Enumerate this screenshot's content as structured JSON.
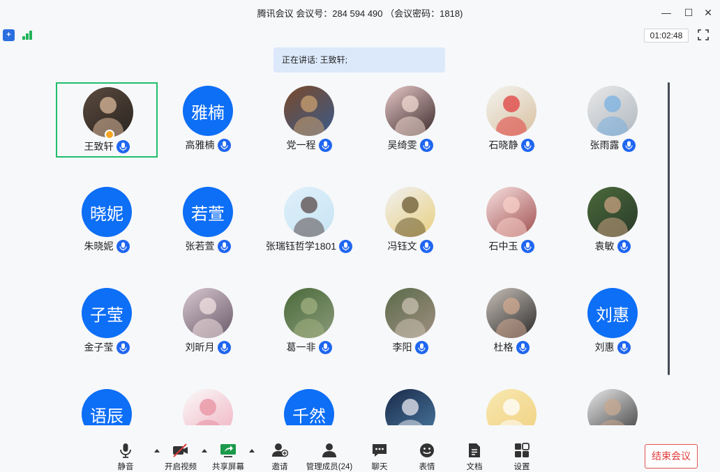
{
  "window": {
    "title": "腾讯会议 会议号：284 594 490 （会议密码：1818)",
    "controls": {
      "minimize": "—",
      "maximize": "☐",
      "close": "✕"
    }
  },
  "status": {
    "shield_label": "+",
    "timer": "01:02:48"
  },
  "speaking": {
    "text": "正在讲话: 王致轩;"
  },
  "participants": [
    {
      "name": "王致轩",
      "avatar_type": "image",
      "colors": [
        "#5a4a3e",
        "#2a2420",
        "#d9b89a"
      ],
      "host": true,
      "active": true
    },
    {
      "name": "高雅楠",
      "avatar_type": "text",
      "avatar_text": "雅楠"
    },
    {
      "name": "党一程",
      "avatar_type": "image",
      "colors": [
        "#7a4a2a",
        "#3a5a8a",
        "#c9a070"
      ]
    },
    {
      "name": "吴绮雯",
      "avatar_type": "image",
      "colors": [
        "#e8c8c8",
        "#3a2a2a",
        "#f0d8d0"
      ]
    },
    {
      "name": "石晓静",
      "avatar_type": "image",
      "colors": [
        "#f4f4f0",
        "#d8c0a0",
        "#e04040"
      ]
    },
    {
      "name": "张雨露",
      "avatar_type": "image",
      "colors": [
        "#e8e8e8",
        "#b0b8c0",
        "#7ab0e0"
      ]
    },
    {
      "name": "朱晓妮",
      "avatar_type": "text",
      "avatar_text": "晓妮"
    },
    {
      "name": "张若萱",
      "avatar_type": "text",
      "avatar_text": "若萱"
    },
    {
      "name": "张瑞钰哲学1801",
      "avatar_type": "image",
      "colors": [
        "#dff0fa",
        "#c8e4f4",
        "#5a4a4a"
      ]
    },
    {
      "name": "冯钰文",
      "avatar_type": "image",
      "colors": [
        "#f0f0f0",
        "#e8d080",
        "#6a5a30"
      ]
    },
    {
      "name": "石中玉",
      "avatar_type": "image",
      "colors": [
        "#f8e0e0",
        "#a05050",
        "#f8d0c8"
      ]
    },
    {
      "name": "袁敏",
      "avatar_type": "image",
      "colors": [
        "#4a6a3a",
        "#2a3a2a",
        "#c8a080"
      ]
    },
    {
      "name": "金子莹",
      "avatar_type": "text",
      "avatar_text": "子莹"
    },
    {
      "name": "刘昕月",
      "avatar_type": "image",
      "colors": [
        "#d8c8d0",
        "#6a5a6a",
        "#f0e0e0"
      ]
    },
    {
      "name": "葛一非",
      "avatar_type": "image",
      "colors": [
        "#4a6a3a",
        "#8a9a7a",
        "#a0b080"
      ]
    },
    {
      "name": "李阳",
      "avatar_type": "image",
      "colors": [
        "#5a6a4a",
        "#a09080",
        "#c8c0b0"
      ]
    },
    {
      "name": "杜格",
      "avatar_type": "image",
      "colors": [
        "#c8c0b8",
        "#2a2a2a",
        "#d0a890"
      ]
    },
    {
      "name": "刘惠",
      "avatar_type": "text",
      "avatar_text": "刘惠"
    },
    {
      "name": "",
      "avatar_type": "text",
      "avatar_text": "语辰"
    },
    {
      "name": "",
      "avatar_type": "image",
      "colors": [
        "#fafafa",
        "#f0b0c0",
        "#e890a0"
      ]
    },
    {
      "name": "",
      "avatar_type": "text",
      "avatar_text": "千然"
    },
    {
      "name": "",
      "avatar_type": "image",
      "colors": [
        "#1a2a4a",
        "#4a7aa0",
        "#e8e8f0"
      ]
    },
    {
      "name": "",
      "avatar_type": "image",
      "colors": [
        "#f8e8b0",
        "#f0d080",
        "#ffffff"
      ]
    },
    {
      "name": "",
      "avatar_type": "image",
      "colors": [
        "#e8e8e8",
        "#3a3a3a",
        "#c8a890"
      ]
    }
  ],
  "toolbar": {
    "items": [
      {
        "label": "静音",
        "icon": "microphone-icon"
      },
      {
        "label": "开启视频",
        "icon": "video-off-icon"
      },
      {
        "label": "共享屏幕",
        "icon": "share-screen-icon"
      },
      {
        "label": "邀请",
        "icon": "invite-user-icon"
      },
      {
        "label": "管理成员(24)",
        "icon": "members-icon"
      },
      {
        "label": "聊天",
        "icon": "chat-icon"
      },
      {
        "label": "表情",
        "icon": "emoji-icon"
      },
      {
        "label": "文档",
        "icon": "document-icon"
      },
      {
        "label": "设置",
        "icon": "settings-grid-icon"
      }
    ],
    "end_meeting": "结束会议"
  },
  "colors": {
    "accent_blue": "#0d6ef6",
    "active_border": "#1fbf6a",
    "end_red": "#e03a3a"
  }
}
